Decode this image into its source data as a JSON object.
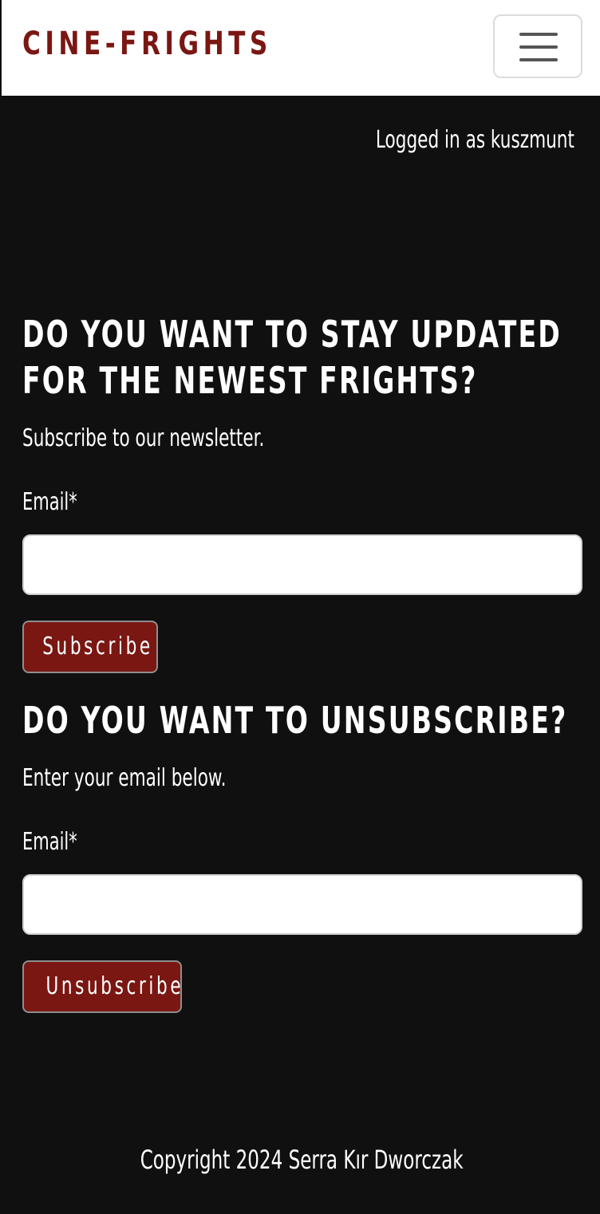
{
  "navbar": {
    "brand": "CINE-FRIGHTS",
    "toggler_icon": "hamburger-menu-icon"
  },
  "status": {
    "logged_in": "Logged in as kuszmunt"
  },
  "subscribe": {
    "heading": "Do you want to stay updated for the newest frights?",
    "subtext": "Subscribe to our newsletter.",
    "email_label": "Email*",
    "email_value": "",
    "button_label": "Subscribe"
  },
  "unsubscribe": {
    "heading": "Do you want to unsubscribe?",
    "subtext": "Enter your email below.",
    "email_label": "Email*",
    "email_value": "",
    "button_label": "Unsubscribe"
  },
  "footer": {
    "copyright": "Copyright 2024 Serra Kır Dworczak"
  },
  "colors": {
    "brand": "#7a1712",
    "background": "#101010",
    "button": "#7a1712"
  }
}
